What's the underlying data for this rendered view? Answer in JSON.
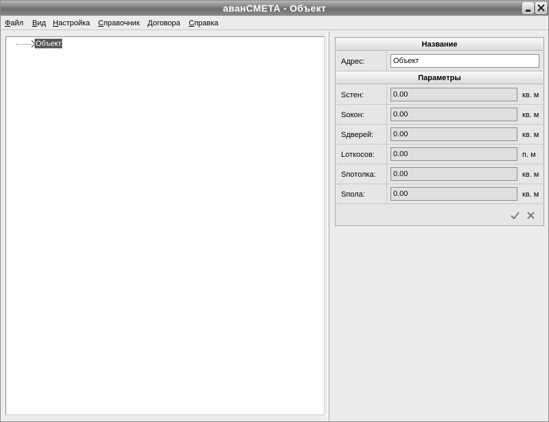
{
  "window": {
    "title": "аванСМЕТА - Объект"
  },
  "menu": [
    {
      "key": "Ф",
      "rest": "айл"
    },
    {
      "key": "В",
      "rest": "ид"
    },
    {
      "key": "Н",
      "rest": "астройка"
    },
    {
      "key": "С",
      "rest": "правочник"
    },
    {
      "key": "Д",
      "rest": "оговора"
    },
    {
      "key": "С",
      "rest": "правка"
    }
  ],
  "tree": {
    "root_label": "Объект"
  },
  "properties": {
    "name_header": "Название",
    "address_label": "Адрес:",
    "address_value": "Объект",
    "params_header": "Параметры",
    "params": [
      {
        "label": "Sстен:",
        "value": "0.00",
        "unit": "кв. м"
      },
      {
        "label": "Sокон:",
        "value": "0.00",
        "unit": "кв. м"
      },
      {
        "label": "Sдверей:",
        "value": "0.00",
        "unit": "кв. м"
      },
      {
        "label": "Lоткосов:",
        "value": "0.00",
        "unit": "п. м"
      },
      {
        "label": "Sпотолка:",
        "value": "0.00",
        "unit": "кв. м"
      },
      {
        "label": "Sпола:",
        "value": "0.00",
        "unit": "кв. м"
      }
    ]
  },
  "icons": {
    "apply": "check-icon",
    "cancel": "close-icon"
  },
  "colors": {
    "titlebar": "#7d7d7d",
    "selection": "#555555",
    "background": "#ececec"
  }
}
